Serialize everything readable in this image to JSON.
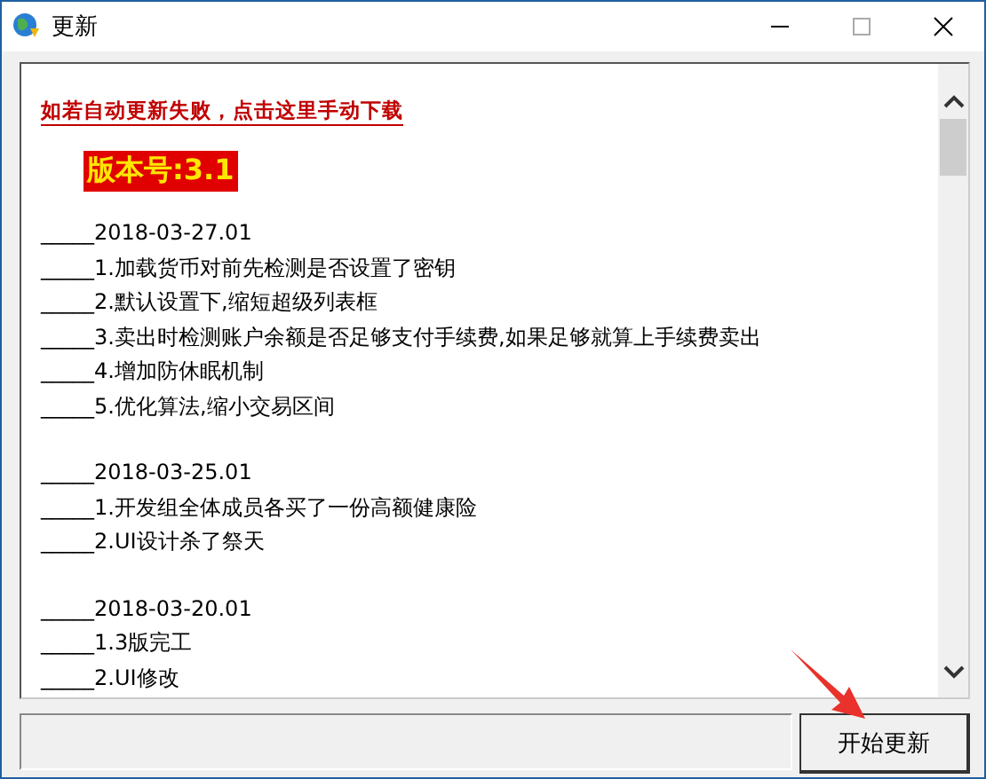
{
  "window": {
    "title": "更新"
  },
  "download_link": "如若自动更新失败，点击这里手动下载",
  "version": "版本号:3.1",
  "changelog": [
    {
      "date": "_____2018-03-27.01",
      "items": [
        "_____1.加载货币对前先检测是否设置了密钥",
        "_____2.默认设置下,缩短超级列表框",
        "_____3.卖出时检测账户余额是否足够支付手续费,如果足够就算上手续费卖出",
        "_____4.增加防休眠机制",
        "_____5.优化算法,缩小交易区间"
      ]
    },
    {
      "date": "_____2018-03-25.01",
      "items": [
        "_____1.开发组全体成员各买了一份高额健康险",
        "_____2.UI设计杀了祭天"
      ]
    },
    {
      "date": "_____2018-03-20.01",
      "items": [
        "_____1.3版完工",
        "_____2.UI修改"
      ]
    }
  ],
  "buttons": [
    "开始更新"
  ],
  "annotation": {
    "kind": "arrow"
  }
}
